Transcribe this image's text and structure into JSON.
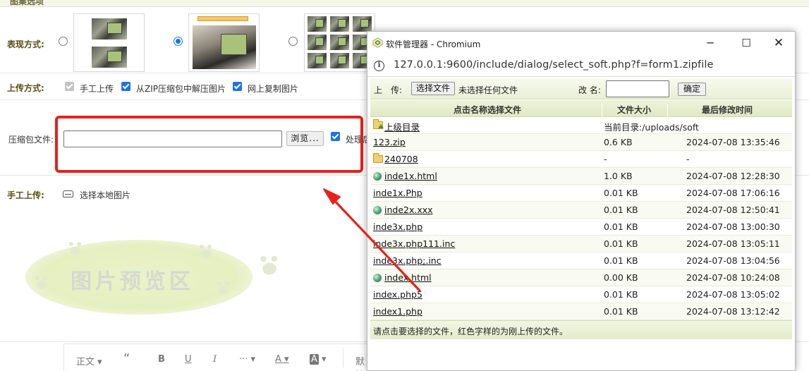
{
  "form": {
    "top_label": "图集选项",
    "display_mode": {
      "label": "表现方式:",
      "options": [
        {
          "name": "side-by-side",
          "selected": false
        },
        {
          "name": "slideshow",
          "selected": true
        },
        {
          "name": "grid",
          "selected": false
        }
      ]
    },
    "upload_mode": {
      "label": "上传方式:",
      "options": [
        {
          "label": "手工上传",
          "checked": true,
          "disabled": true
        },
        {
          "label": "从ZIP压缩包中解压图片",
          "checked": true,
          "disabled": false
        },
        {
          "label": "网上复制图片",
          "checked": true,
          "disabled": false
        }
      ]
    },
    "zip_file": {
      "label": "压缩包文件:",
      "value": "",
      "browse_label": "浏览...",
      "process_label": "处理后",
      "process_checked": true
    },
    "manual_upload": {
      "label": "手工上传:",
      "select_label": "选择本地图片"
    },
    "preview_area_text": "图片预览区",
    "editor_toolbar": {
      "paragraph": "正文",
      "quote": "“",
      "bold": "B",
      "underline": "U",
      "italic": "I",
      "more": "···",
      "font_color": "A",
      "bg_color": "A",
      "default_label": "默认"
    }
  },
  "popup": {
    "window_title": "软件管理器 - Chromium",
    "url": "127.0.0.1:9600/include/dialog/select_soft.php?f=form1.zipfile",
    "upload_label": "上　传:",
    "choose_file_label": "选择文件",
    "no_file_text": "未选择任何文件",
    "rename_label": "改 名:",
    "rename_value": "",
    "confirm_label": "确定",
    "columns": {
      "name": "点击名称选择文件",
      "size": "文件大小",
      "modified": "最后修改时间"
    },
    "rows": [
      {
        "name": "上级目录",
        "icon": "parent-dir",
        "size": "当前目录:/uploads/soft",
        "modified": ""
      },
      {
        "name": "123.zip",
        "icon": "",
        "size": "0.6 KB",
        "modified": "2024-07-08 13:35:46"
      },
      {
        "name": "240708",
        "icon": "folder",
        "size": "-",
        "modified": "-"
      },
      {
        "name": "inde1x.html",
        "icon": "globe",
        "size": "1.0 KB",
        "modified": "2024-07-08 12:28:30"
      },
      {
        "name": "inde1x.Php",
        "icon": "",
        "size": "0.01 KB",
        "modified": "2024-07-08 17:06:16"
      },
      {
        "name": "inde2x.xxx",
        "icon": "globe",
        "size": "0.01 KB",
        "modified": "2024-07-08 12:50:41"
      },
      {
        "name": "inde3x.php",
        "icon": "",
        "size": "0.01 KB",
        "modified": "2024-07-08 13:00:30"
      },
      {
        "name": "inde3x.php111.inc",
        "icon": "",
        "size": "0.01 KB",
        "modified": "2024-07-08 13:05:11"
      },
      {
        "name": "inde3x.php;.inc",
        "icon": "",
        "size": "0.01 KB",
        "modified": "2024-07-08 13:04:56"
      },
      {
        "name": "index.html",
        "icon": "globe",
        "size": "0.00 KB",
        "modified": "2024-07-08 10:24:08"
      },
      {
        "name": "index.php5",
        "icon": "",
        "size": "0.01 KB",
        "modified": "2024-07-08 13:05:02"
      },
      {
        "name": "index1.php",
        "icon": "",
        "size": "0.01 KB",
        "modified": "2024-07-08 13:12:42"
      }
    ],
    "footer_text": "请点击要选择的文件，红色字样的为刚上传的文件。"
  },
  "colors": {
    "annotation_red": "#e8211a",
    "accent_blue": "#1a73e8",
    "toolbar_green": "#eaf0d6"
  }
}
